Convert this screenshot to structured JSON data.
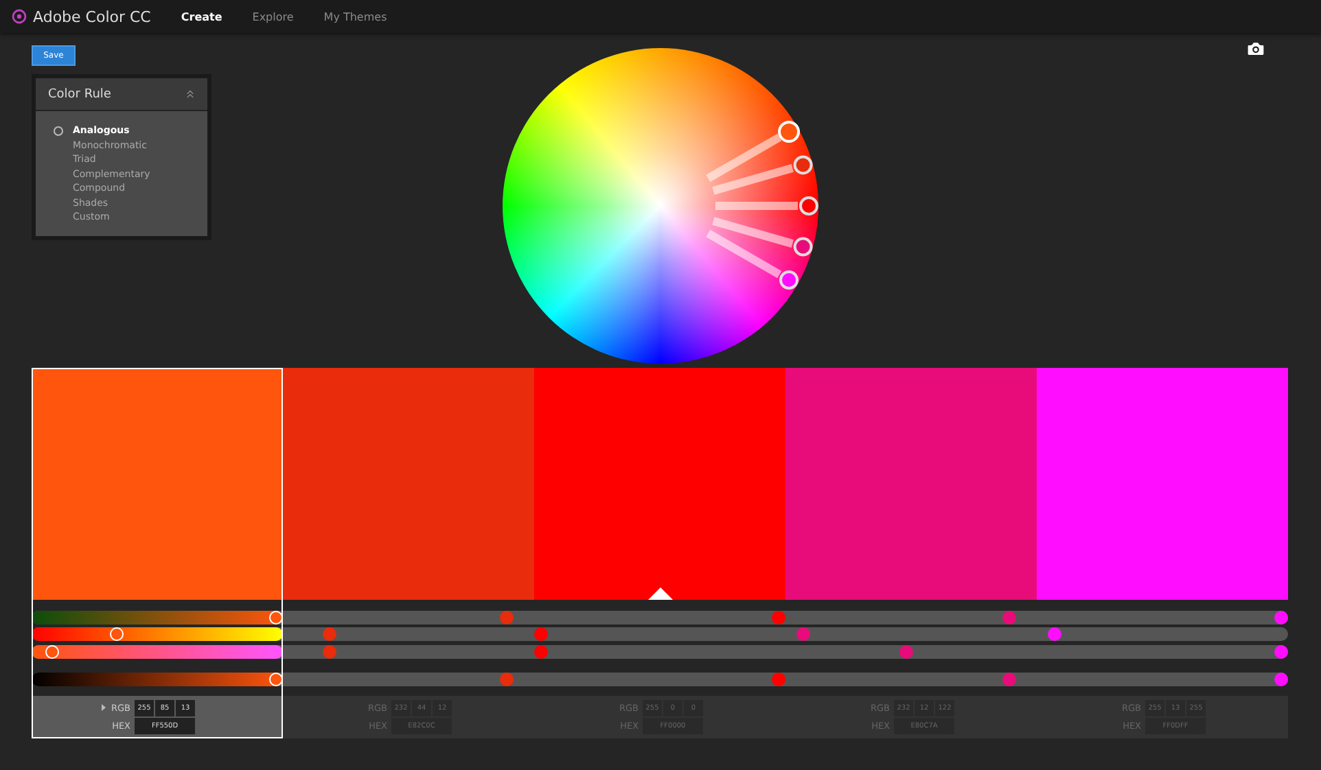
{
  "app": {
    "title": "Adobe Color CC"
  },
  "nav": [
    {
      "label": "Create",
      "selected": true
    },
    {
      "label": "Explore",
      "selected": false
    },
    {
      "label": "My Themes",
      "selected": false
    }
  ],
  "save_button": "Save",
  "color_rule": {
    "title": "Color Rule",
    "expanded": true,
    "options": [
      {
        "label": "Analogous",
        "selected": true
      },
      {
        "label": "Monochromatic",
        "selected": false
      },
      {
        "label": "Triad",
        "selected": false
      },
      {
        "label": "Complementary",
        "selected": false
      },
      {
        "label": "Compound",
        "selected": false
      },
      {
        "label": "Shades",
        "selected": false
      },
      {
        "label": "Custom",
        "selected": false
      }
    ]
  },
  "swatches": [
    {
      "color": "#ff550d",
      "selected": true,
      "base": false,
      "sliders": [
        {
          "level": 0.97
        },
        {
          "level": 0.34
        },
        {
          "level": 0.08
        },
        {
          "level": 0.97
        }
      ],
      "rgb_label": "RGB",
      "rgb": [
        "255",
        "85",
        "13"
      ],
      "hex_label": "HEX",
      "hex": "FF550D"
    },
    {
      "color": "#e82c0c",
      "selected": false,
      "base": false,
      "sliders": [
        {
          "level": 0.378
        },
        {
          "level": 0.237
        },
        {
          "level": 0.237
        },
        {
          "level": 0.378
        }
      ],
      "rgb_label": "RGB",
      "rgb": [
        "232",
        "44",
        "12"
      ],
      "hex_label": "HEX",
      "hex": "E82C0C"
    },
    {
      "color": "#ff0000",
      "selected": false,
      "base": true,
      "sliders": [
        {
          "level": 0.595
        },
        {
          "level": 0.405
        },
        {
          "level": 0.405
        },
        {
          "level": 0.595
        }
      ],
      "rgb_label": "RGB",
      "rgb": [
        "255",
        "0",
        "0"
      ],
      "hex_label": "HEX",
      "hex": "FF0000"
    },
    {
      "color": "#e80c7a",
      "selected": false,
      "base": false,
      "sliders": [
        {
          "level": 0.778
        },
        {
          "level": 0.614
        },
        {
          "level": 0.696
        },
        {
          "level": 0.778
        }
      ],
      "rgb_label": "RGB",
      "rgb": [
        "232",
        "12",
        "122"
      ],
      "hex_label": "HEX",
      "hex": "E80C7A"
    },
    {
      "color": "#ff0dff",
      "selected": false,
      "base": false,
      "sliders": [
        {
          "level": 0.995
        },
        {
          "level": 0.814
        },
        {
          "level": 0.995
        },
        {
          "level": 0.995
        }
      ],
      "rgb_label": "RGB",
      "rgb": [
        "255",
        "13",
        "255"
      ],
      "hex_label": "HEX",
      "hex": "FF0DFF"
    }
  ]
}
